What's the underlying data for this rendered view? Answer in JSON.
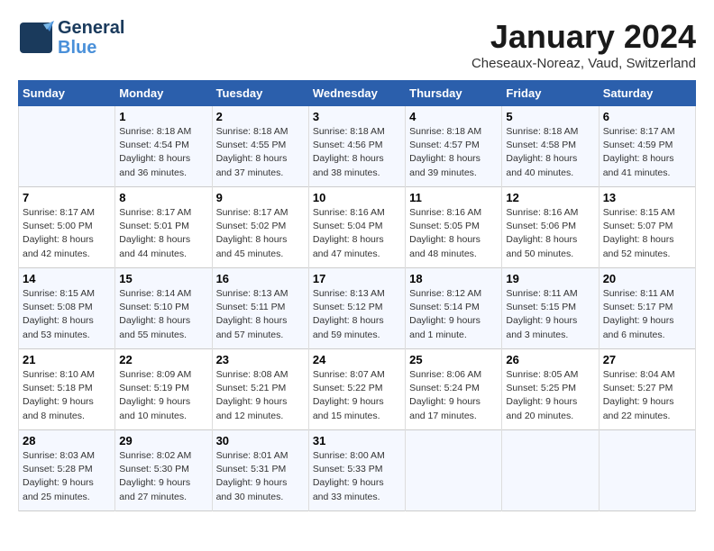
{
  "logo": {
    "line1": "General",
    "line2": "Blue"
  },
  "title": "January 2024",
  "location": "Cheseaux-Noreaz, Vaud, Switzerland",
  "weekdays": [
    "Sunday",
    "Monday",
    "Tuesday",
    "Wednesday",
    "Thursday",
    "Friday",
    "Saturday"
  ],
  "weeks": [
    [
      {
        "day": "",
        "info": ""
      },
      {
        "day": "1",
        "info": "Sunrise: 8:18 AM\nSunset: 4:54 PM\nDaylight: 8 hours\nand 36 minutes."
      },
      {
        "day": "2",
        "info": "Sunrise: 8:18 AM\nSunset: 4:55 PM\nDaylight: 8 hours\nand 37 minutes."
      },
      {
        "day": "3",
        "info": "Sunrise: 8:18 AM\nSunset: 4:56 PM\nDaylight: 8 hours\nand 38 minutes."
      },
      {
        "day": "4",
        "info": "Sunrise: 8:18 AM\nSunset: 4:57 PM\nDaylight: 8 hours\nand 39 minutes."
      },
      {
        "day": "5",
        "info": "Sunrise: 8:18 AM\nSunset: 4:58 PM\nDaylight: 8 hours\nand 40 minutes."
      },
      {
        "day": "6",
        "info": "Sunrise: 8:17 AM\nSunset: 4:59 PM\nDaylight: 8 hours\nand 41 minutes."
      }
    ],
    [
      {
        "day": "7",
        "info": "Sunrise: 8:17 AM\nSunset: 5:00 PM\nDaylight: 8 hours\nand 42 minutes."
      },
      {
        "day": "8",
        "info": "Sunrise: 8:17 AM\nSunset: 5:01 PM\nDaylight: 8 hours\nand 44 minutes."
      },
      {
        "day": "9",
        "info": "Sunrise: 8:17 AM\nSunset: 5:02 PM\nDaylight: 8 hours\nand 45 minutes."
      },
      {
        "day": "10",
        "info": "Sunrise: 8:16 AM\nSunset: 5:04 PM\nDaylight: 8 hours\nand 47 minutes."
      },
      {
        "day": "11",
        "info": "Sunrise: 8:16 AM\nSunset: 5:05 PM\nDaylight: 8 hours\nand 48 minutes."
      },
      {
        "day": "12",
        "info": "Sunrise: 8:16 AM\nSunset: 5:06 PM\nDaylight: 8 hours\nand 50 minutes."
      },
      {
        "day": "13",
        "info": "Sunrise: 8:15 AM\nSunset: 5:07 PM\nDaylight: 8 hours\nand 52 minutes."
      }
    ],
    [
      {
        "day": "14",
        "info": "Sunrise: 8:15 AM\nSunset: 5:08 PM\nDaylight: 8 hours\nand 53 minutes."
      },
      {
        "day": "15",
        "info": "Sunrise: 8:14 AM\nSunset: 5:10 PM\nDaylight: 8 hours\nand 55 minutes."
      },
      {
        "day": "16",
        "info": "Sunrise: 8:13 AM\nSunset: 5:11 PM\nDaylight: 8 hours\nand 57 minutes."
      },
      {
        "day": "17",
        "info": "Sunrise: 8:13 AM\nSunset: 5:12 PM\nDaylight: 8 hours\nand 59 minutes."
      },
      {
        "day": "18",
        "info": "Sunrise: 8:12 AM\nSunset: 5:14 PM\nDaylight: 9 hours\nand 1 minute."
      },
      {
        "day": "19",
        "info": "Sunrise: 8:11 AM\nSunset: 5:15 PM\nDaylight: 9 hours\nand 3 minutes."
      },
      {
        "day": "20",
        "info": "Sunrise: 8:11 AM\nSunset: 5:17 PM\nDaylight: 9 hours\nand 6 minutes."
      }
    ],
    [
      {
        "day": "21",
        "info": "Sunrise: 8:10 AM\nSunset: 5:18 PM\nDaylight: 9 hours\nand 8 minutes."
      },
      {
        "day": "22",
        "info": "Sunrise: 8:09 AM\nSunset: 5:19 PM\nDaylight: 9 hours\nand 10 minutes."
      },
      {
        "day": "23",
        "info": "Sunrise: 8:08 AM\nSunset: 5:21 PM\nDaylight: 9 hours\nand 12 minutes."
      },
      {
        "day": "24",
        "info": "Sunrise: 8:07 AM\nSunset: 5:22 PM\nDaylight: 9 hours\nand 15 minutes."
      },
      {
        "day": "25",
        "info": "Sunrise: 8:06 AM\nSunset: 5:24 PM\nDaylight: 9 hours\nand 17 minutes."
      },
      {
        "day": "26",
        "info": "Sunrise: 8:05 AM\nSunset: 5:25 PM\nDaylight: 9 hours\nand 20 minutes."
      },
      {
        "day": "27",
        "info": "Sunrise: 8:04 AM\nSunset: 5:27 PM\nDaylight: 9 hours\nand 22 minutes."
      }
    ],
    [
      {
        "day": "28",
        "info": "Sunrise: 8:03 AM\nSunset: 5:28 PM\nDaylight: 9 hours\nand 25 minutes."
      },
      {
        "day": "29",
        "info": "Sunrise: 8:02 AM\nSunset: 5:30 PM\nDaylight: 9 hours\nand 27 minutes."
      },
      {
        "day": "30",
        "info": "Sunrise: 8:01 AM\nSunset: 5:31 PM\nDaylight: 9 hours\nand 30 minutes."
      },
      {
        "day": "31",
        "info": "Sunrise: 8:00 AM\nSunset: 5:33 PM\nDaylight: 9 hours\nand 33 minutes."
      },
      {
        "day": "",
        "info": ""
      },
      {
        "day": "",
        "info": ""
      },
      {
        "day": "",
        "info": ""
      }
    ]
  ]
}
